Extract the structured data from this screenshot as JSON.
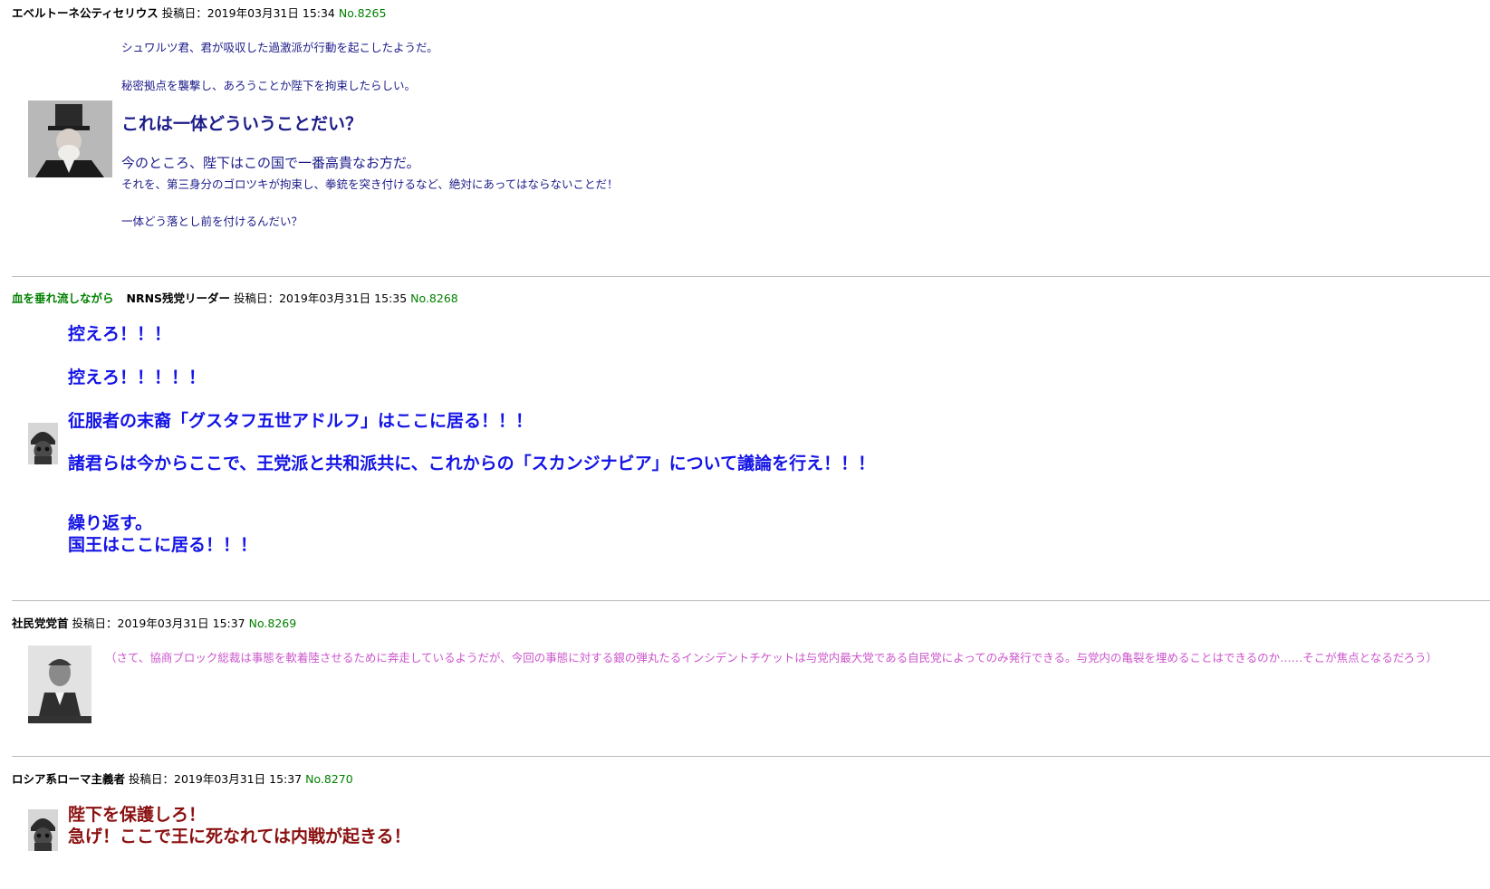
{
  "posts": [
    {
      "prefix": "",
      "name": "エベルトーネ公ティセリウス",
      "label": "投稿日：",
      "date": "2019年03月31日 15:34",
      "no": "No.8265",
      "lines": [
        "シュワルツ君、君が吸収した過激派が行動を起こしたようだ。",
        "秘密拠点を襲撃し、あろうことか陛下を拘束したらしい。",
        "これは一体どういうことだい？",
        "今のところ、陛下はこの国で一番高貴なお方だ。",
        "それを、第三身分のゴロツキが拘束し、拳銃を突き付けるなど、絶対にあってはならないことだ！",
        "一体どう落とし前を付けるんだい？"
      ]
    },
    {
      "prefix": "血を垂れ流しながら",
      "name": "NRNS残党リーダー",
      "label": "投稿日：",
      "date": "2019年03月31日 15:35",
      "no": "No.8268",
      "lines": [
        "控えろ！！！",
        "控えろ！！！！！",
        "征服者の末裔「グスタフ五世アドルフ」はここに居る！！！",
        "諸君らは今からここで、王党派と共和派共に、これからの「スカンジナビア」について議論を行え！！！",
        "繰り返す。",
        "国王はここに居る！！！"
      ]
    },
    {
      "prefix": "",
      "name": "社民党党首",
      "label": "投稿日：",
      "date": "2019年03月31日 15:37",
      "no": "No.8269",
      "lines": [
        "（さて、協商ブロック総裁は事態を軟着陸させるために奔走しているようだが、今回の事態に対する銀の弾丸たるインシデントチケットは与党内最大党である自民党によってのみ発行できる。与党内の亀裂を埋めることはできるのか……そこが焦点となるだろう）"
      ]
    },
    {
      "prefix": "",
      "name": "ロシア系ローマ主義者",
      "label": "投稿日：",
      "date": "2019年03月31日 15:37",
      "no": "No.8270",
      "lines": [
        "陛下を保護しろ！",
        "急げ！ここで王に死なれては内戦が起きる！"
      ]
    }
  ],
  "colors": {
    "navy": "#1c1c8a",
    "blue": "#1414e6",
    "pink": "#cc55cc",
    "maroon": "#8b1010",
    "green": "#008000"
  }
}
